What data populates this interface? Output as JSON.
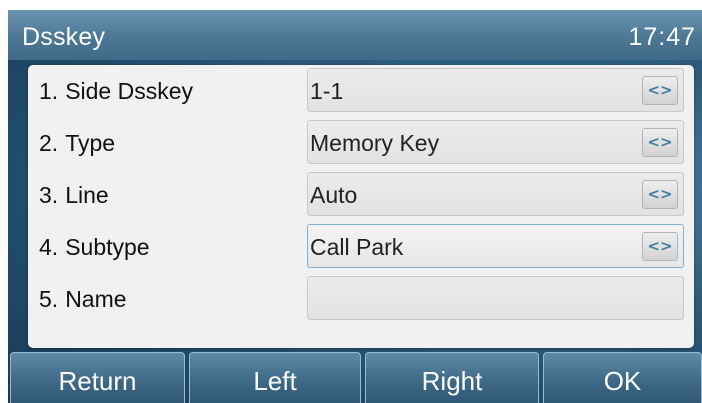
{
  "header": {
    "title": "Dsskey",
    "time": "17:47"
  },
  "rows": [
    {
      "number": "1.",
      "label": "Side Dsskey",
      "value": "1-1",
      "switch_icon": "<>"
    },
    {
      "number": "2.",
      "label": "Type",
      "value": "Memory Key",
      "switch_icon": "<>"
    },
    {
      "number": "3.",
      "label": "Line",
      "value": "Auto",
      "switch_icon": "<>"
    },
    {
      "number": "4.",
      "label": "Subtype",
      "value": "Call Park",
      "switch_icon": "<>"
    },
    {
      "number": "5.",
      "label": "Name",
      "value": ""
    }
  ],
  "softkeys": [
    "Return",
    "Left",
    "Right",
    "OK"
  ],
  "colors": {
    "accent": "#3c7fa6",
    "title_bar": "#4d7895",
    "active_border": "#7fb1cf"
  }
}
